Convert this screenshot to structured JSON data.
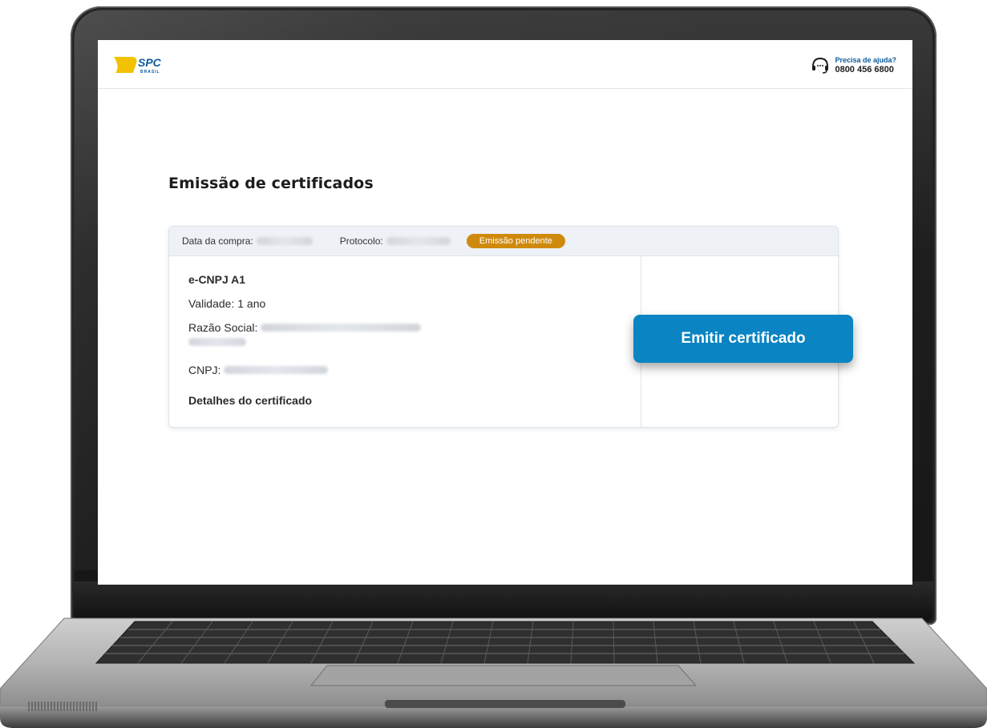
{
  "header": {
    "logo_text": "SPC",
    "logo_subtext": "BRASIL",
    "help_title": "Precisa de ajuda?",
    "help_phone": "0800 456 6800"
  },
  "main": {
    "title": "Emissão de certificados"
  },
  "card": {
    "purchase_date_label": "Data da compra:",
    "protocol_label": "Protocolo:",
    "status_badge": "Emissão pendente",
    "product_name": "e-CNPJ A1",
    "validity": "Validade: 1 ano",
    "company_label": "Razão Social:",
    "cnpj_label": "CNPJ:",
    "details_link": "Detalhes do certificado"
  },
  "actions": {
    "emit_label": "Emitir certificado"
  },
  "colors": {
    "brand_blue": "#0a84c2",
    "link_blue": "#0a7fc0",
    "badge_orange": "#cf8a0e",
    "logo_yellow": "#f2c200"
  }
}
